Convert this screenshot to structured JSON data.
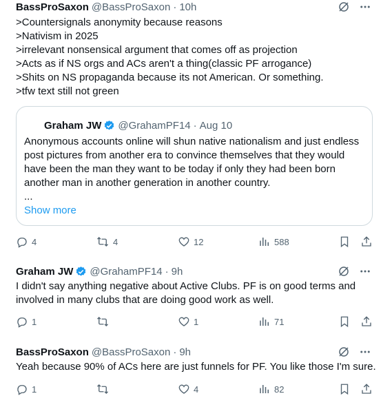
{
  "tweets": [
    {
      "name": "BassProSaxon",
      "handle": "@BassProSaxon",
      "time": "10h",
      "lines": [
        ">Countersignals anonymity because reasons",
        ">Nativism in 2025",
        ">irrelevant nonsensical argument that comes off as projection",
        ">Acts as if NS orgs and ACs aren't a thing(classic PF arrogance)",
        ">Shits on NS propaganda because its not American. Or something.",
        ">tfw text still not green"
      ],
      "quote": {
        "name": "Graham JW",
        "handle": "@GrahamPF14",
        "time": "Aug 10",
        "lines": [
          "Anonymous accounts online will shun native nationalism and just endless",
          "post pictures from another era to convince themselves that they would",
          "have been the man they want to be today if only they had been born",
          "another man in another generation in another country.",
          "..."
        ],
        "show_more": "Show more"
      },
      "stats": {
        "replies": "4",
        "reposts": "4",
        "likes": "12",
        "views": "588"
      }
    },
    {
      "name": "Graham JW",
      "handle": "@GrahamPF14",
      "time": "9h",
      "lines": [
        "I didn't say anything negative about Active Clubs. PF is on good terms and",
        "involved in many clubs that are doing good work as well."
      ],
      "stats": {
        "replies": "1",
        "reposts": "",
        "likes": "1",
        "views": "71"
      }
    },
    {
      "name": "BassProSaxon",
      "handle": "@BassProSaxon",
      "time": "9h",
      "lines": [
        "Yeah because 90% of ACs here are just funnels for PF. You like those I'm sure."
      ],
      "stats": {
        "replies": "1",
        "reposts": "",
        "likes": "4",
        "views": "82"
      }
    }
  ],
  "separator": "·",
  "colors": {
    "text": "#0f1419",
    "secondary": "#536471",
    "link": "#1d9bf0",
    "verified": "#1d9bf0",
    "border": "#cfd9de"
  },
  "icons": [
    "grok-icon",
    "more-icon",
    "reply-icon",
    "repost-icon",
    "like-icon",
    "views-icon",
    "bookmark-icon",
    "share-icon",
    "verified-badge-icon"
  ]
}
